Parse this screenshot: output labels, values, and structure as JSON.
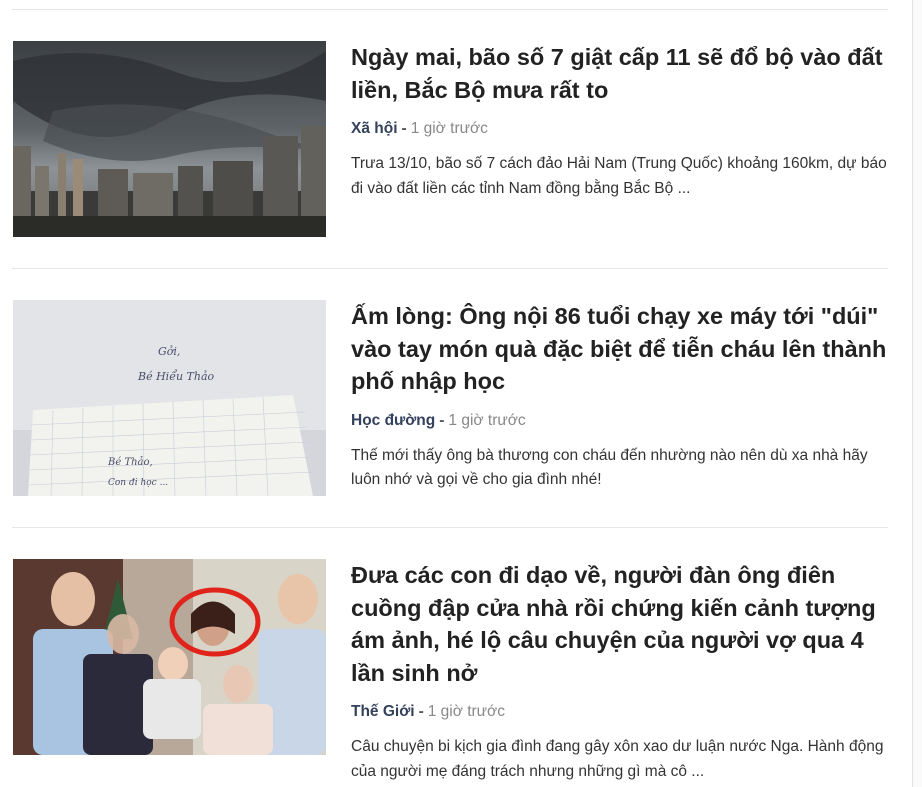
{
  "articles": [
    {
      "title": "Ngày mai, bão số 7 giật cấp 11 sẽ đổ bộ vào đất liền, Bắc Bộ mưa rất to",
      "category": "Xã hội",
      "separator": "-",
      "time": "1 giờ trước",
      "summary": "Trưa 13/10, bão số 7 cách đảo Hải Nam (Trung Quốc) khoảng 160km, dự báo đi vào đất liền các tỉnh Nam đồng bằng Bắc Bộ ..."
    },
    {
      "title": "Ấm lòng: Ông nội 86 tuổi chạy xe máy tới \"dúi\" vào tay món quà đặc biệt để tiễn cháu lên thành phố nhập học",
      "category": "Học đường",
      "separator": "-",
      "time": "1 giờ trước",
      "summary": "Thế mới thấy ông bà thương con cháu đến nhường nào nên dù xa nhà hãy luôn nhớ và gọi về cho gia đình nhé!"
    },
    {
      "title": "Đưa các con đi dạo về, người đàn ông điên cuồng đập cửa nhà rồi chứng kiến cảnh tượng ám ảnh, hé lộ câu chuyện của người vợ qua 4 lần sinh nở",
      "category": "Thế Giới",
      "separator": "-",
      "time": "1 giờ trước",
      "summary": "Câu chuyện bi kịch gia đình đang gây xôn xao dư luận nước Nga. Hành động của người mẹ đáng trách nhưng những gì mà cô ..."
    }
  ],
  "images": {
    "note_handwriting": [
      "Gởi,",
      "Bé Hiểu Thảo",
      "Bé Thảo,",
      "Con đi học ..."
    ]
  }
}
